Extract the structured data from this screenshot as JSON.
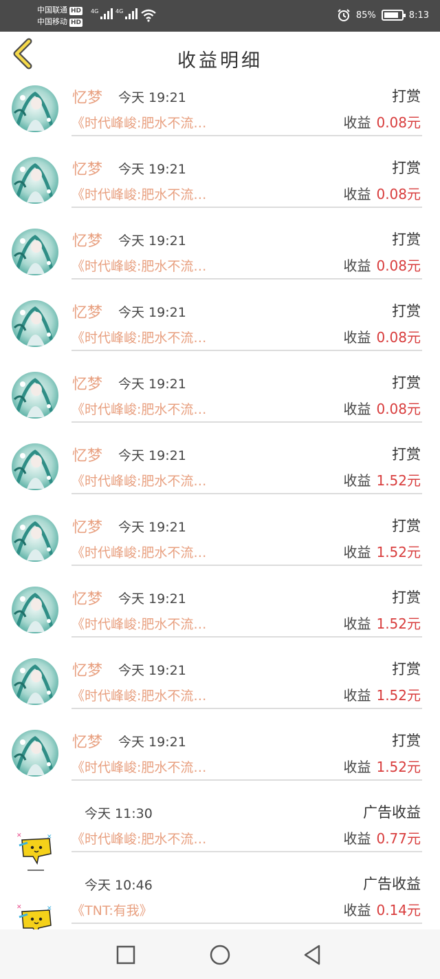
{
  "status_bar": {
    "carrier1": "中国联通",
    "carrier2": "中国移动",
    "hd": "HD",
    "net1": "4G",
    "net2": "4G",
    "battery_pct": "85%",
    "battery_level": 0.85,
    "time": "8:13"
  },
  "header": {
    "title": "收益明细"
  },
  "entries": [
    {
      "name": "忆梦",
      "time": "今天 19:21",
      "book": "《时代峰峻:肥水不流…",
      "type": "打赏",
      "income_label": "收益",
      "amount": "0.08元",
      "avatar": "anime-avatar"
    },
    {
      "name": "忆梦",
      "time": "今天 19:21",
      "book": "《时代峰峻:肥水不流…",
      "type": "打赏",
      "income_label": "收益",
      "amount": "0.08元",
      "avatar": "anime-avatar"
    },
    {
      "name": "忆梦",
      "time": "今天 19:21",
      "book": "《时代峰峻:肥水不流…",
      "type": "打赏",
      "income_label": "收益",
      "amount": "0.08元",
      "avatar": "anime-avatar"
    },
    {
      "name": "忆梦",
      "time": "今天 19:21",
      "book": "《时代峰峻:肥水不流…",
      "type": "打赏",
      "income_label": "收益",
      "amount": "0.08元",
      "avatar": "anime-avatar"
    },
    {
      "name": "忆梦",
      "time": "今天 19:21",
      "book": "《时代峰峻:肥水不流…",
      "type": "打赏",
      "income_label": "收益",
      "amount": "0.08元",
      "avatar": "anime-avatar"
    },
    {
      "name": "忆梦",
      "time": "今天 19:21",
      "book": "《时代峰峻:肥水不流…",
      "type": "打赏",
      "income_label": "收益",
      "amount": "1.52元",
      "avatar": "anime-avatar"
    },
    {
      "name": "忆梦",
      "time": "今天 19:21",
      "book": "《时代峰峻:肥水不流…",
      "type": "打赏",
      "income_label": "收益",
      "amount": "1.52元",
      "avatar": "anime-avatar"
    },
    {
      "name": "忆梦",
      "time": "今天 19:21",
      "book": "《时代峰峻:肥水不流…",
      "type": "打赏",
      "income_label": "收益",
      "amount": "1.52元",
      "avatar": "anime-avatar"
    },
    {
      "name": "忆梦",
      "time": "今天 19:21",
      "book": "《时代峰峻:肥水不流…",
      "type": "打赏",
      "income_label": "收益",
      "amount": "1.52元",
      "avatar": "anime-avatar"
    },
    {
      "name": "忆梦",
      "time": "今天 19:21",
      "book": "《时代峰峻:肥水不流…",
      "type": "打赏",
      "income_label": "收益",
      "amount": "1.52元",
      "avatar": "anime-avatar"
    },
    {
      "name": "",
      "time": "今天 11:30",
      "book": "《时代峰峻:肥水不流…",
      "type": "广告收益",
      "income_label": "收益",
      "amount": "0.77元",
      "avatar": "chat-bubble-emoji"
    },
    {
      "name": "",
      "time": "今天 10:46",
      "book": "《TNT:有我》",
      "type": "广告收益",
      "income_label": "收益",
      "amount": "0.14元",
      "avatar": "chat-bubble-emoji"
    }
  ],
  "nav": {
    "icons": [
      "square-icon",
      "circle-icon",
      "triangle-back-icon"
    ]
  },
  "colors": {
    "accent": "#e8a080",
    "amount": "#d83c3c",
    "status_bar": "#4a4a4a"
  }
}
